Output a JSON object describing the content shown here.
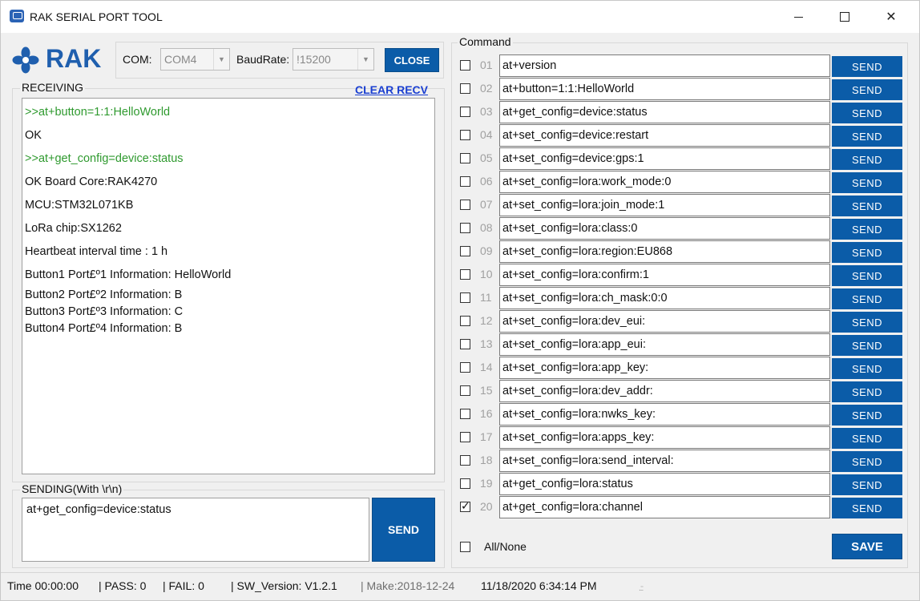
{
  "window": {
    "title": "RAK SERIAL PORT TOOL",
    "controls": {
      "minimize": "minimize",
      "maximize": "maximize",
      "close": "close"
    }
  },
  "logo": {
    "text": "RAK",
    "brand_color": "#1f5fae"
  },
  "connection": {
    "com_label": "COM:",
    "com_value": "COM4",
    "baud_label": "BaudRate:",
    "baud_value": "!15200",
    "close_button": "CLOSE"
  },
  "receiving": {
    "title": "RECEIVING",
    "clear_button": "CLEAR RECV",
    "lines": [
      {
        "prefix": ">>",
        "text": "at+button=1:1:HelloWorld"
      },
      {
        "prefix": "",
        "text": "OK"
      },
      {
        "prefix": ">>",
        "text": "at+get_config=device:status"
      },
      {
        "prefix": "",
        "text": "OK Board Core:RAK4270"
      },
      {
        "prefix": "",
        "text": "MCU:STM32L071KB"
      },
      {
        "prefix": "",
        "text": "LoRa chip:SX1262"
      },
      {
        "prefix": "",
        "text": "Heartbeat interval time : 1 h"
      },
      {
        "prefix": "",
        "text": "Button1 Port£º1 Information: HelloWorld"
      },
      {
        "prefix": "",
        "text": "Button2 Port£º2 Information: B"
      },
      {
        "prefix": "",
        "text": "Button3 Port£º3 Information: C"
      },
      {
        "prefix": "",
        "text": "Button4 Port£º4 Information: B"
      }
    ]
  },
  "sending": {
    "title": "SENDING(With \\r\\n)",
    "value": "at+get_config=device:status",
    "send_button": "SEND"
  },
  "command": {
    "title": "Command",
    "send_label": "SEND",
    "rows": [
      {
        "num": "01",
        "text": "at+version",
        "checked": false
      },
      {
        "num": "02",
        "text": "at+button=1:1:HelloWorld",
        "checked": false
      },
      {
        "num": "03",
        "text": "at+get_config=device:status",
        "checked": false
      },
      {
        "num": "04",
        "text": "at+set_config=device:restart",
        "checked": false
      },
      {
        "num": "05",
        "text": "at+set_config=device:gps:1",
        "checked": false
      },
      {
        "num": "06",
        "text": "at+set_config=lora:work_mode:0",
        "checked": false
      },
      {
        "num": "07",
        "text": "at+set_config=lora:join_mode:1",
        "checked": false
      },
      {
        "num": "08",
        "text": "at+set_config=lora:class:0",
        "checked": false
      },
      {
        "num": "09",
        "text": "at+set_config=lora:region:EU868",
        "checked": false
      },
      {
        "num": "10",
        "text": "at+set_config=lora:confirm:1",
        "checked": false
      },
      {
        "num": "11",
        "text": "at+set_config=lora:ch_mask:0:0",
        "checked": false
      },
      {
        "num": "12",
        "text": "at+set_config=lora:dev_eui:",
        "checked": false
      },
      {
        "num": "13",
        "text": "at+set_config=lora:app_eui:",
        "checked": false
      },
      {
        "num": "14",
        "text": "at+set_config=lora:app_key:",
        "checked": false
      },
      {
        "num": "15",
        "text": "at+set_config=lora:dev_addr:",
        "checked": false
      },
      {
        "num": "16",
        "text": "at+set_config=lora:nwks_key:",
        "checked": false
      },
      {
        "num": "17",
        "text": "at+set_config=lora:apps_key:",
        "checked": false
      },
      {
        "num": "18",
        "text": "at+set_config=lora:send_interval:",
        "checked": false
      },
      {
        "num": "19",
        "text": "at+get_config=lora:status",
        "checked": false
      },
      {
        "num": "20",
        "text": "at+get_config=lora:channel",
        "checked": true
      }
    ],
    "all_none_label": "All/None",
    "save_button": "SAVE"
  },
  "statusbar": {
    "time": "Time  00:00:00",
    "pass": "| PASS:  0",
    "fail": "| FAIL:  0",
    "sw_version": "| SW_Version:  V1.2.1",
    "make": "| Make:2018-12-24",
    "datetime": "11/18/2020 6:34:14 PM"
  },
  "colors": {
    "button_blue": "#0b5ca8",
    "link_blue": "#1a3fd1",
    "command_echo_green": "#2f9a2f",
    "row_number_gray": "#a0a0a0"
  }
}
